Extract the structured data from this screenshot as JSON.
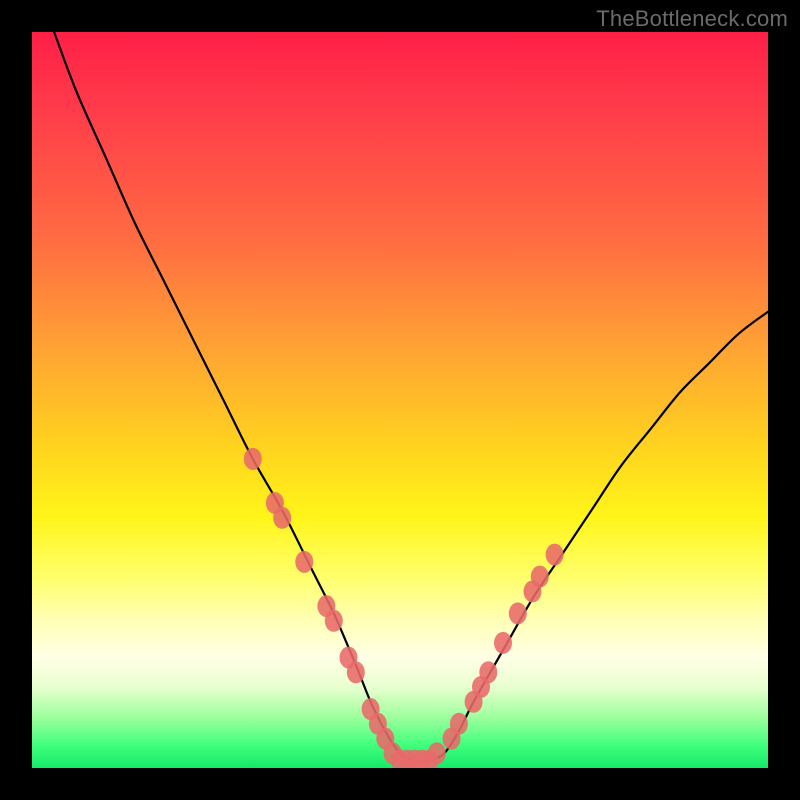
{
  "watermark": "TheBottleneck.com",
  "colors": {
    "frame": "#000000",
    "curve": "#000000",
    "dots": "#e86a6a",
    "dots_stroke": "#c94f4f"
  },
  "chart_data": {
    "type": "line",
    "title": "",
    "xlabel": "",
    "ylabel": "",
    "xlim": [
      0,
      100
    ],
    "ylim": [
      0,
      100
    ],
    "grid": false,
    "legend": false,
    "annotations": [
      "TheBottleneck.com"
    ],
    "description": "V-shaped bottleneck curve with a flat minimum; left branch steep, right branch shallower. Salmon/pink dots cluster along the curve near and just above the minimum on both sides.",
    "series": [
      {
        "name": "bottleneck-curve",
        "x": [
          3,
          6,
          10,
          14,
          18,
          22,
          26,
          30,
          34,
          38,
          41,
          44,
          46,
          48,
          50,
          52,
          54,
          56,
          58,
          60,
          64,
          68,
          72,
          76,
          80,
          84,
          88,
          92,
          96,
          100
        ],
        "y": [
          100,
          92,
          83,
          74,
          66,
          58,
          50,
          42,
          35,
          27,
          21,
          14,
          9,
          5,
          2,
          1,
          1,
          2,
          5,
          9,
          16,
          23,
          29,
          35,
          41,
          46,
          51,
          55,
          59,
          62
        ]
      }
    ],
    "dots": [
      {
        "x": 30,
        "y": 42
      },
      {
        "x": 33,
        "y": 36
      },
      {
        "x": 34,
        "y": 34
      },
      {
        "x": 37,
        "y": 28
      },
      {
        "x": 40,
        "y": 22
      },
      {
        "x": 41,
        "y": 20
      },
      {
        "x": 43,
        "y": 15
      },
      {
        "x": 44,
        "y": 13
      },
      {
        "x": 46,
        "y": 8
      },
      {
        "x": 47,
        "y": 6
      },
      {
        "x": 48,
        "y": 4
      },
      {
        "x": 49,
        "y": 2
      },
      {
        "x": 50,
        "y": 1
      },
      {
        "x": 51,
        "y": 1
      },
      {
        "x": 52,
        "y": 1
      },
      {
        "x": 53,
        "y": 1
      },
      {
        "x": 54,
        "y": 1
      },
      {
        "x": 55,
        "y": 2
      },
      {
        "x": 57,
        "y": 4
      },
      {
        "x": 58,
        "y": 6
      },
      {
        "x": 60,
        "y": 9
      },
      {
        "x": 61,
        "y": 11
      },
      {
        "x": 62,
        "y": 13
      },
      {
        "x": 64,
        "y": 17
      },
      {
        "x": 66,
        "y": 21
      },
      {
        "x": 68,
        "y": 24
      },
      {
        "x": 69,
        "y": 26
      },
      {
        "x": 71,
        "y": 29
      }
    ]
  }
}
